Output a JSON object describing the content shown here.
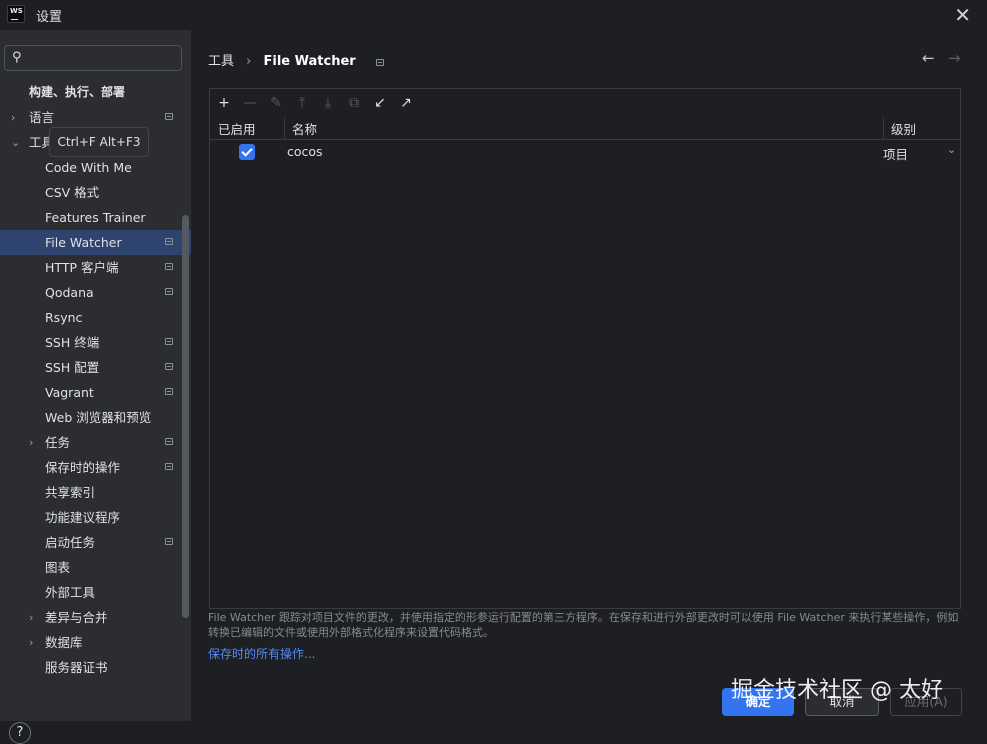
{
  "window": {
    "app_logo_text": "WS",
    "title": "设置",
    "close_icon": "close-icon"
  },
  "sidebar": {
    "search": {
      "value": "",
      "placeholder": ""
    },
    "tooltip": "Ctrl+F Alt+F3",
    "items": [
      {
        "label": "构建、执行、部署",
        "arrow": "",
        "bold": true
      },
      {
        "label": "语言",
        "arrow": "›",
        "proj": true
      },
      {
        "label": "工具",
        "arrow": "⌄"
      },
      {
        "label": "Code With Me"
      },
      {
        "label": "CSV 格式"
      },
      {
        "label": "Features Trainer"
      },
      {
        "label": "File Watcher",
        "selected": true,
        "proj": true
      },
      {
        "label": "HTTP 客户端",
        "proj": true
      },
      {
        "label": "Qodana",
        "proj": true
      },
      {
        "label": "Rsync"
      },
      {
        "label": "SSH 终端",
        "proj": true
      },
      {
        "label": "SSH 配置",
        "proj": true
      },
      {
        "label": "Vagrant",
        "proj": true
      },
      {
        "label": "Web 浏览器和预览"
      },
      {
        "label": "任务",
        "arrow": "›",
        "proj": true
      },
      {
        "label": "保存时的操作",
        "proj": true
      },
      {
        "label": "共享索引"
      },
      {
        "label": "功能建议程序"
      },
      {
        "label": "启动任务",
        "proj": true
      },
      {
        "label": "图表"
      },
      {
        "label": "外部工具"
      },
      {
        "label": "差异与合并",
        "arrow": "›"
      },
      {
        "label": "数据库",
        "arrow": "›"
      },
      {
        "label": "服务器证书"
      }
    ],
    "help_label": "?"
  },
  "main": {
    "breadcrumb": {
      "parent": "工具",
      "separator": "›",
      "current": "File Watcher"
    },
    "nav": {
      "back": "←",
      "forward": "→"
    },
    "toolbar": [
      {
        "name": "add-icon",
        "glyph": "+",
        "enabled": true
      },
      {
        "name": "remove-icon",
        "glyph": "—",
        "enabled": false
      },
      {
        "name": "edit-icon",
        "glyph": "✎",
        "enabled": false
      },
      {
        "name": "move-up-icon",
        "glyph": "⤒",
        "enabled": false
      },
      {
        "name": "move-down-icon",
        "glyph": "⤓",
        "enabled": false
      },
      {
        "name": "copy-icon",
        "glyph": "⧉",
        "enabled": false
      },
      {
        "name": "import-icon",
        "glyph": "↙",
        "enabled": true
      },
      {
        "name": "export-icon",
        "glyph": "↗",
        "enabled": true
      }
    ],
    "table": {
      "headers": {
        "enabled": "已启用",
        "name": "名称",
        "level": "级别"
      },
      "rows": [
        {
          "enabled": true,
          "name": "cocos",
          "level": "项目"
        }
      ]
    },
    "description": "File Watcher 跟踪对项目文件的更改，并使用指定的形参运行配置的第三方程序。在保存和进行外部更改时可以使用 File Watcher 来执行某些操作，例如转换已编辑的文件或使用外部格式化程序来设置代码格式。",
    "link": "保存时的所有操作..."
  },
  "buttons": {
    "ok": "确定",
    "cancel": "取消",
    "apply": "应用(A)"
  },
  "watermark": "掘金技术社区 @ 太好",
  "colors": {
    "accent": "#3574f0",
    "selection": "#2e436e",
    "link": "#548af7",
    "background": "#1e1f22",
    "sidebar": "#2b2d30"
  }
}
